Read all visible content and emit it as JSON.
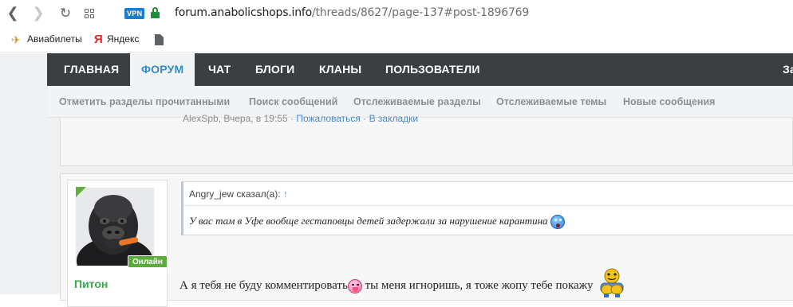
{
  "browser": {
    "url_host": "forum.anabolicshops.info",
    "url_path": "/threads/8627/page-137#post-1896769",
    "vpn_label": "VPN",
    "bookmarks": [
      {
        "label": "Авиабилеты",
        "icon": "plane-icon"
      },
      {
        "label": "Яндекс",
        "icon": "yandex-icon"
      },
      {
        "label": "",
        "icon": "document-icon"
      }
    ]
  },
  "main_nav": {
    "items": [
      {
        "label": "ГЛАВНАЯ",
        "active": false
      },
      {
        "label": "ФОРУМ",
        "active": true
      },
      {
        "label": "ЧАТ",
        "active": false
      },
      {
        "label": "БЛОГИ",
        "active": false
      },
      {
        "label": "КЛАНЫ",
        "active": false
      },
      {
        "label": "ПОЛЬЗОВАТЕЛИ",
        "active": false
      },
      {
        "label": "За",
        "active": false
      }
    ]
  },
  "sub_nav": {
    "links": [
      "Отметить разделы прочитанными",
      "Поиск сообщений",
      "Отслеживаемые разделы",
      "Отслеживаемые темы",
      "Новые сообщения"
    ]
  },
  "prev_post": {
    "author_time": "AlexSpb, Вчера, в 19:55",
    "report": "Пожаловаться",
    "bookmark": "В закладки"
  },
  "post": {
    "username": "Питон",
    "status": "Онлайн",
    "quote": {
      "author": "Angry_jew сказал(а):",
      "arrow": "↑",
      "text": "У вас там в Уфе вообще гестаповцы детей задержали за нарушение карантина"
    },
    "message_part1": "А я тебя не буду комментировать",
    "message_part2": " ты меня игноришь, я тоже жопу тебе покажу"
  },
  "colors": {
    "nav_bg": "#3c3f42",
    "active_tab_text": "#2f8ec9",
    "online_green": "#5aad3a",
    "username_green": "#3aa84c"
  }
}
